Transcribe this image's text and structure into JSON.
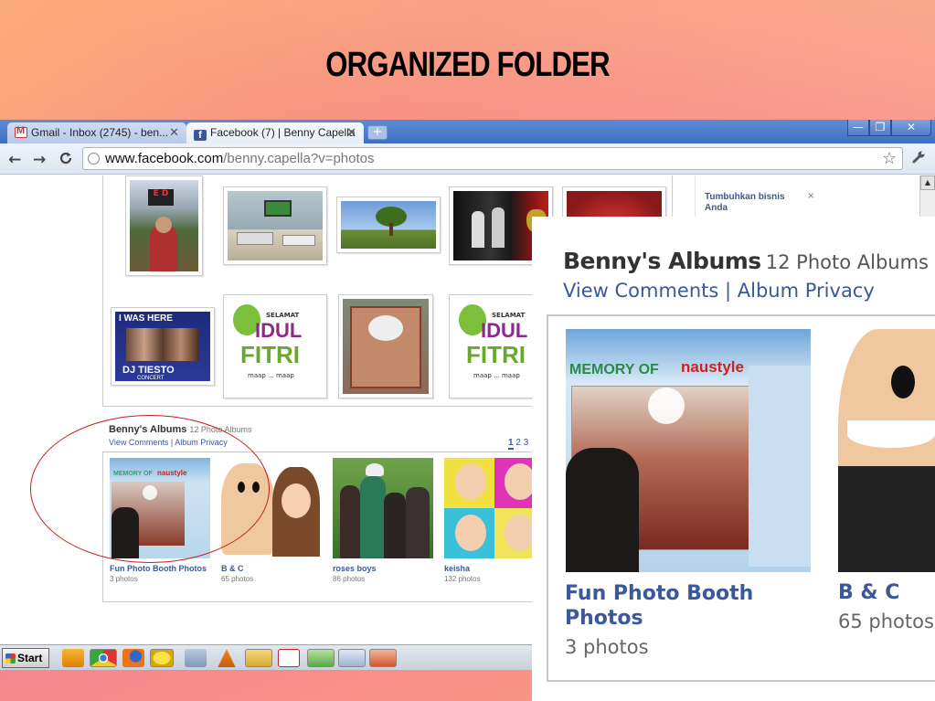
{
  "slide": {
    "title": "ORGANIZED FOLDER"
  },
  "browser": {
    "tabs": [
      {
        "label": "Gmail - Inbox (2745) - ben...",
        "icon": "gmail-icon",
        "active": false
      },
      {
        "label": "Facebook (7) | Benny Capella",
        "icon": "facebook-icon",
        "active": true
      }
    ],
    "new_tab_label": "+",
    "window_controls": {
      "minimize": "—",
      "maximize": "❐",
      "close": "✕"
    },
    "nav": {
      "back": "←",
      "forward": "→",
      "reload": "C"
    },
    "url_host": "www.facebook.com",
    "url_path": "/benny.capella?v=photos",
    "star": "☆",
    "wrench": "🔧"
  },
  "sidebar_ad": {
    "title": "Tumbuhkan bisnis Anda",
    "close": "×"
  },
  "photos": {
    "thumbs": [
      "street-photo",
      "living-room",
      "tree",
      "stage-ironman",
      "red-frame",
      "i-was-here-dj-tiesto",
      "selamat-idul-fitri",
      "building-sign",
      "selamat-idul-fitri-2"
    ],
    "i_was_here": "I WAS HERE",
    "dj_tiesto": "DJ TIESTO",
    "concert": "CONCERT",
    "selamat": "SELAMAT",
    "idul": "IDUL",
    "fitri": "FITRI",
    "maap": "maap ... maap"
  },
  "albums": {
    "owner_title": "Benny's Albums",
    "count_text": "12 Photo Albums",
    "view_comments": "View Comments",
    "separator": " | ",
    "album_privacy": "Album Privacy",
    "pages": [
      "1",
      "2",
      "3"
    ],
    "current_page": "1",
    "items": [
      {
        "name": "Fun Photo Booth Photos",
        "count": "3 photos"
      },
      {
        "name": "B & C",
        "count": "65 photos"
      },
      {
        "name": "roses boys",
        "count": "86 photos"
      },
      {
        "name": "keisha",
        "count": "132 photos"
      }
    ],
    "memory_of": "MEMORY OF",
    "brand": "naustyle"
  },
  "taskbar": {
    "start_label": "Start",
    "icons": [
      "media-player-icon",
      "chrome-icon",
      "firefox-icon",
      "messenger-icon",
      "document-icon",
      "vlc-icon",
      "folder-icon",
      "pdf-icon",
      "network-icon",
      "notepad-icon",
      "presentation-icon"
    ]
  },
  "zoom": {
    "title": "Benny's Albums",
    "count_text": "12 Photo Albums",
    "view_comments": "View Comments",
    "separator": " | ",
    "album_privacy": "Album Privacy",
    "album1_name": "Fun Photo Booth Photos",
    "album1_count": "3 photos",
    "album2_name": "B & C",
    "album2_count": "65 photos"
  },
  "colors": {
    "facebook_link": "#3b5998",
    "highlight_ellipse": "#c81e1e",
    "slide_bg": "#f6808a"
  }
}
